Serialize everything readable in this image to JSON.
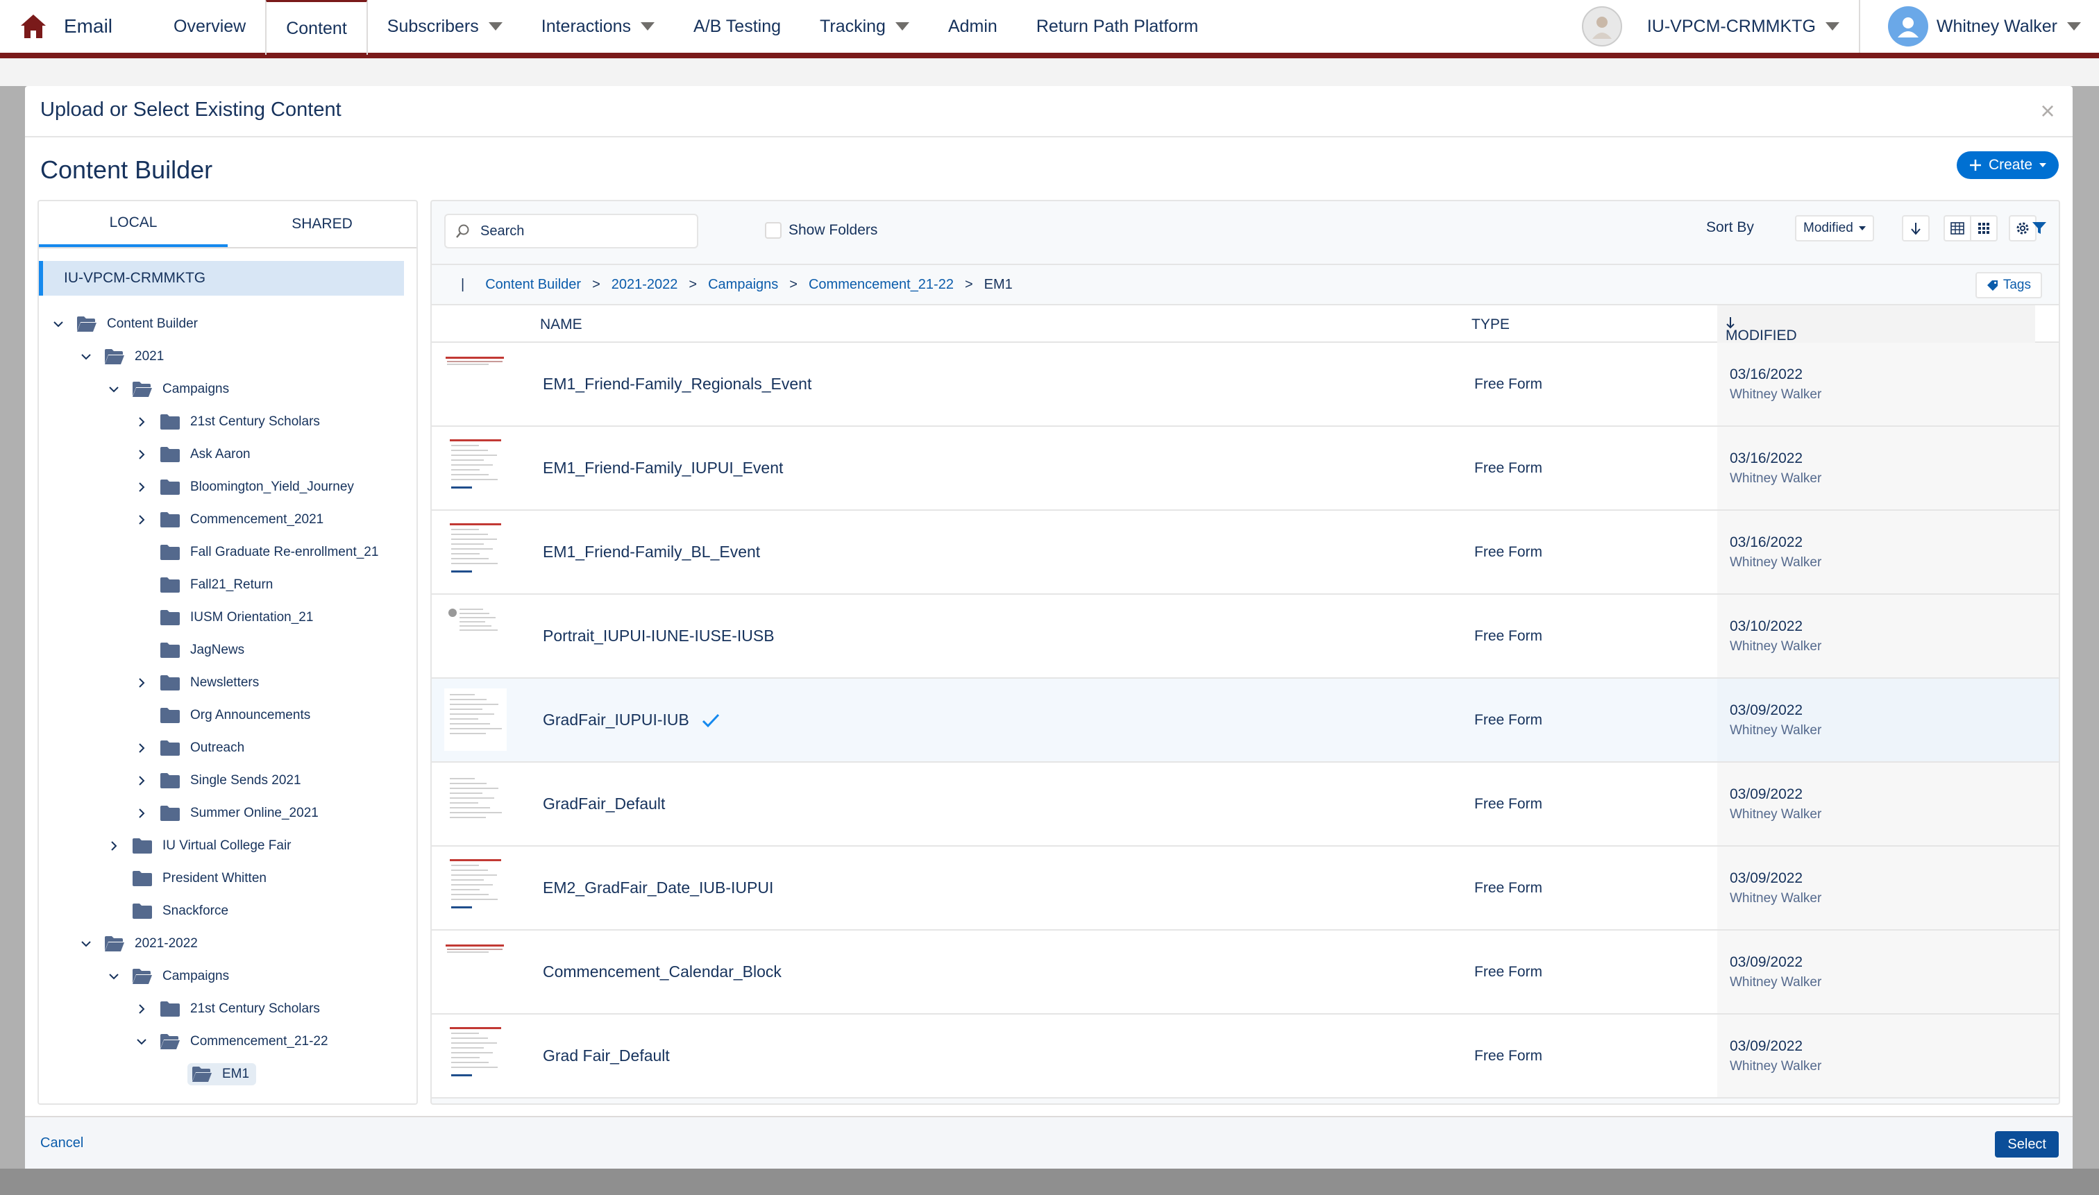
{
  "app": {
    "title": "Email"
  },
  "nav": {
    "items": [
      {
        "label": "Overview",
        "has_caret": false
      },
      {
        "label": "Content",
        "has_caret": false,
        "active": true
      },
      {
        "label": "Subscribers",
        "has_caret": true
      },
      {
        "label": "Interactions",
        "has_caret": true
      },
      {
        "label": "A/B Testing",
        "has_caret": false
      },
      {
        "label": "Tracking",
        "has_caret": true
      },
      {
        "label": "Admin",
        "has_caret": false
      },
      {
        "label": "Return Path Platform",
        "has_caret": false
      }
    ],
    "business_unit": "IU-VPCM-CRMMKTG",
    "user": "Whitney Walker"
  },
  "modal": {
    "title": "Upload or Select Existing Content",
    "section_title": "Content Builder",
    "create_label": "Create",
    "cancel_label": "Cancel",
    "select_label": "Select"
  },
  "left": {
    "tabs": [
      "LOCAL",
      "SHARED"
    ],
    "business_unit": "IU-VPCM-CRMMKTG",
    "tree": [
      {
        "label": "Content Builder",
        "depth": 0,
        "chevron": "down",
        "open": true
      },
      {
        "label": "2021",
        "depth": 1,
        "chevron": "down",
        "open": true
      },
      {
        "label": "Campaigns",
        "depth": 2,
        "chevron": "down",
        "open": true
      },
      {
        "label": "21st Century Scholars",
        "depth": 3,
        "chevron": "right"
      },
      {
        "label": "Ask Aaron",
        "depth": 3,
        "chevron": "right"
      },
      {
        "label": "Bloomington_Yield_Journey",
        "depth": 3,
        "chevron": "right"
      },
      {
        "label": "Commencement_2021",
        "depth": 3,
        "chevron": "right"
      },
      {
        "label": "Fall Graduate Re-enrollment_21",
        "depth": 3,
        "chevron": "none"
      },
      {
        "label": "Fall21_Return",
        "depth": 3,
        "chevron": "none"
      },
      {
        "label": "IUSM Orientation_21",
        "depth": 3,
        "chevron": "none"
      },
      {
        "label": "JagNews",
        "depth": 3,
        "chevron": "none"
      },
      {
        "label": "Newsletters",
        "depth": 3,
        "chevron": "right"
      },
      {
        "label": "Org Announcements",
        "depth": 3,
        "chevron": "none"
      },
      {
        "label": "Outreach",
        "depth": 3,
        "chevron": "right"
      },
      {
        "label": "Single Sends 2021",
        "depth": 3,
        "chevron": "right"
      },
      {
        "label": "Summer Online_2021",
        "depth": 3,
        "chevron": "right"
      },
      {
        "label": "IU Virtual College Fair",
        "depth": 2,
        "chevron": "right"
      },
      {
        "label": "President Whitten",
        "depth": 2,
        "chevron": "none"
      },
      {
        "label": "Snackforce",
        "depth": 2,
        "chevron": "none"
      },
      {
        "label": "2021-2022",
        "depth": 1,
        "chevron": "down",
        "open": true
      },
      {
        "label": "Campaigns",
        "depth": 2,
        "chevron": "down",
        "open": true
      },
      {
        "label": "21st Century Scholars",
        "depth": 3,
        "chevron": "right"
      },
      {
        "label": "Commencement_21-22",
        "depth": 3,
        "chevron": "down",
        "open": true
      },
      {
        "label": "EM1",
        "depth": 4,
        "chevron": "none",
        "selected": true,
        "open": true
      }
    ]
  },
  "toolbar": {
    "search_placeholder": "Search",
    "show_folders": "Show Folders",
    "sort_by": "Sort By",
    "sort_value": "Modified",
    "tags": "Tags"
  },
  "breadcrumb": {
    "items": [
      "Content Builder",
      "2021-2022",
      "Campaigns",
      "Commencement_21-22"
    ],
    "current": "EM1",
    "separator": ">"
  },
  "table": {
    "headers": {
      "name": "NAME",
      "type": "TYPE",
      "modified": "MODIFIED"
    },
    "rows": [
      {
        "name": "EM1_Friend-Family_Regionals_Event",
        "type": "Free Form",
        "date": "03/16/2022",
        "author": "Whitney Walker",
        "thumb": "banner"
      },
      {
        "name": "EM1_Friend-Family_IUPUI_Event",
        "type": "Free Form",
        "date": "03/16/2022",
        "author": "Whitney Walker",
        "thumb": "doc-red"
      },
      {
        "name": "EM1_Friend-Family_BL_Event",
        "type": "Free Form",
        "date": "03/16/2022",
        "author": "Whitney Walker",
        "thumb": "doc-red"
      },
      {
        "name": "Portrait_IUPUI-IUNE-IUSE-IUSB",
        "type": "Free Form",
        "date": "03/10/2022",
        "author": "Whitney Walker",
        "thumb": "portrait"
      },
      {
        "name": "GradFair_IUPUI-IUB",
        "type": "Free Form",
        "date": "03/09/2022",
        "author": "Whitney Walker",
        "thumb": "doc",
        "selected": true
      },
      {
        "name": "GradFair_Default",
        "type": "Free Form",
        "date": "03/09/2022",
        "author": "Whitney Walker",
        "thumb": "doc"
      },
      {
        "name": "EM2_GradFair_Date_IUB-IUPUI",
        "type": "Free Form",
        "date": "03/09/2022",
        "author": "Whitney Walker",
        "thumb": "doc-red"
      },
      {
        "name": "Commencement_Calendar_Block",
        "type": "Free Form",
        "date": "03/09/2022",
        "author": "Whitney Walker",
        "thumb": "banner"
      },
      {
        "name": "Grad Fair_Default",
        "type": "Free Form",
        "date": "03/09/2022",
        "author": "Whitney Walker",
        "thumb": "doc-red"
      }
    ]
  },
  "colors": {
    "accent": "#0070d2",
    "brand": "#7a1a1a",
    "text": "#16325c"
  }
}
